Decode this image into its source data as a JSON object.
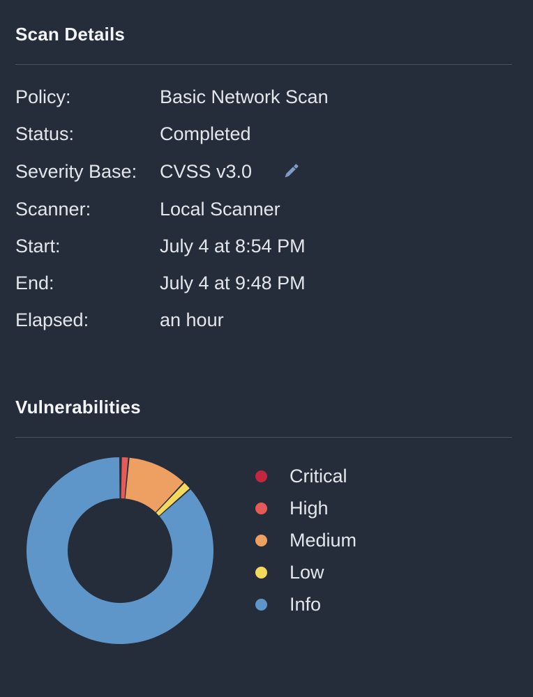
{
  "scan_details": {
    "title": "Scan Details",
    "rows": [
      {
        "label": "Policy:",
        "value": "Basic Network Scan"
      },
      {
        "label": "Status:",
        "value": "Completed"
      },
      {
        "label": "Severity Base:",
        "value": "CVSS v3.0"
      },
      {
        "label": "Scanner:",
        "value": "Local Scanner"
      },
      {
        "label": "Start:",
        "value": "July 4 at 8:54 PM"
      },
      {
        "label": "End:",
        "value": "July 4 at 9:48 PM"
      },
      {
        "label": "Elapsed:",
        "value": "an hour"
      }
    ],
    "edit_icon": "pencil-icon"
  },
  "vulnerabilities": {
    "title": "Vulnerabilities",
    "legend": [
      {
        "label": "Critical",
        "color": "#c3273f"
      },
      {
        "label": "High",
        "color": "#e45b57"
      },
      {
        "label": "Medium",
        "color": "#eea062"
      },
      {
        "label": "Low",
        "color": "#f5d95c"
      },
      {
        "label": "Info",
        "color": "#5e96c9"
      }
    ]
  },
  "chart_data": {
    "type": "pie",
    "title": "",
    "categories": [
      "Critical",
      "High",
      "Medium",
      "Low",
      "Info"
    ],
    "values": [
      0.2,
      1.3,
      10.5,
      1.5,
      86.5
    ],
    "unit": "percent of findings (estimated)",
    "colors": [
      "#c3273f",
      "#e45b57",
      "#eea062",
      "#f5d95c",
      "#5e96c9"
    ],
    "donut": true,
    "legend_position": "right"
  }
}
